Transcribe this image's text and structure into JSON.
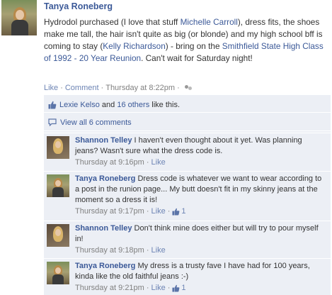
{
  "post": {
    "author": "Tanya Roneberg",
    "text_parts": {
      "t1": "Hydrodol purchased (I love that stuff ",
      "link1": "Michelle Carroll",
      "t2": "), dress fits, the shoes make me tall, the hair isn't quite as big (or blonde) and my high school bff is coming to stay (",
      "link2": "Kelly Richardson",
      "t3": ") - bring on the ",
      "link3": "Smithfield State High Class of 1992 - 20 Year Reunion",
      "t4": ". Can't wait for Saturday night!"
    },
    "actions": {
      "like": "Like",
      "dot1": "·",
      "comment": "Comment",
      "dot2": "·",
      "timestamp": "Thursday at 8:22pm",
      "dot3": "·"
    }
  },
  "feedback": {
    "likes": {
      "name": "Lexie Kelso",
      "and": " and ",
      "others": "16 others",
      "suffix": " like this."
    },
    "view_all": "View all 6 comments"
  },
  "comments": [
    {
      "author": "Shannon Telley",
      "text": "I haven't even thought about it yet. Was planning jeans? Wasn't sure what the dress code is.",
      "time": "Thursday at 9:16pm",
      "dot": "·",
      "like": "Like",
      "likes": ""
    },
    {
      "author": "Tanya Roneberg",
      "text": "Dress code is whatever we want to wear according to a post in the runion page... My butt doesn't fit in my skinny jeans at the moment so a dress it is!",
      "time": "Thursday at 9:17pm",
      "dot": "·",
      "like": "Like",
      "dot2": "·",
      "likes": "1"
    },
    {
      "author": "Shannon Telley",
      "text": "Don't think mine does either but will try to pour myself in!",
      "time": "Thursday at 9:18pm",
      "dot": "·",
      "like": "Like",
      "likes": ""
    },
    {
      "author": "Tanya Roneberg",
      "text": "My dress is a trusty fave I have had for 100 years, kinda like the old faithful jeans :-)",
      "time": "Thursday at 9:21pm",
      "dot": "·",
      "like": "Like",
      "dot2": "·",
      "likes": "1"
    }
  ],
  "colors": {
    "link": "#3b5998",
    "meta_link": "#6d84b4",
    "feedback_bg": "#eceff5",
    "meta_text": "#808080"
  },
  "icons": {
    "audience": "friends-icon",
    "like": "thumbs-up-icon",
    "comments": "comment-bubble-icon"
  }
}
